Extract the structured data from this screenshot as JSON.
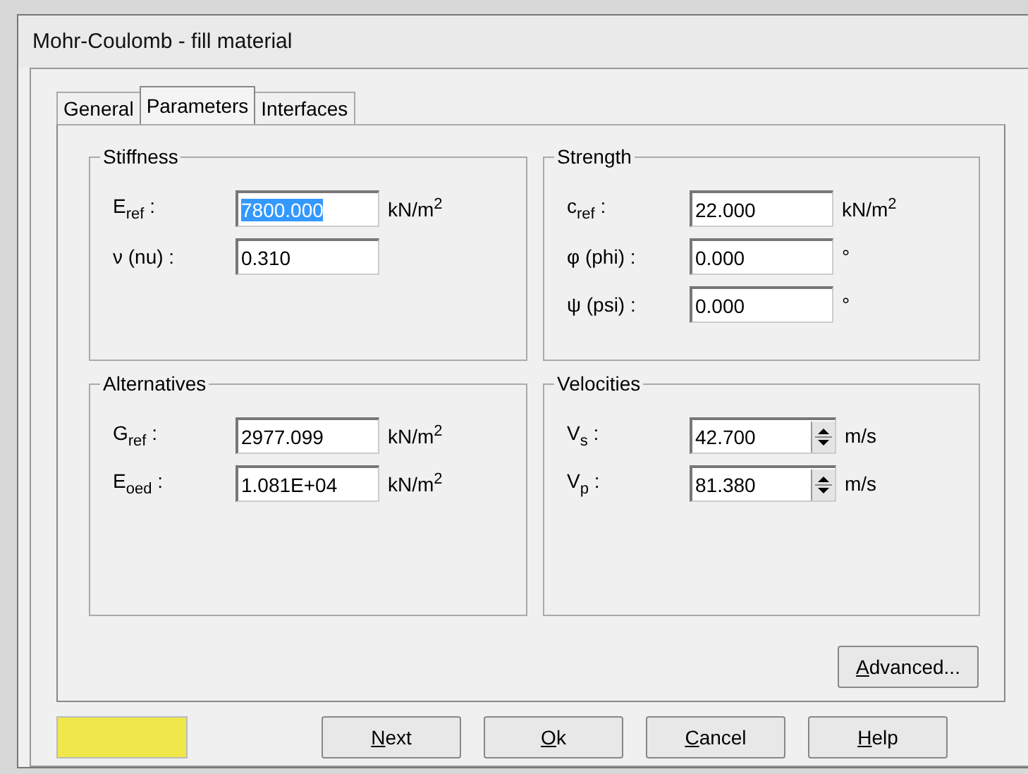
{
  "window": {
    "title": "Mohr-Coulomb - fill material"
  },
  "tabs": [
    {
      "label": "General",
      "selected": false
    },
    {
      "label": "Parameters",
      "selected": true
    },
    {
      "label": "Interfaces",
      "selected": false
    }
  ],
  "groups": [
    {
      "title": "Stiffness",
      "fields": [
        {
          "label": "E$_{ref}$ :",
          "value": "7800.000",
          "unit": "kN/m$^{2}$",
          "kind": "text",
          "selected": true
        },
        {
          "label": "ν (nu) :",
          "value": "0.310",
          "kind": "text",
          "selected": false
        }
      ]
    },
    {
      "title": "Strength",
      "fields": [
        {
          "label": "c$_{ref}$ :",
          "value": "22.000",
          "unit": "kN/m$^{2}$",
          "kind": "text",
          "selected": false
        },
        {
          "label": "φ (phi) :",
          "value": "0.000",
          "unit": "°",
          "kind": "text",
          "selected": false
        },
        {
          "label": "ψ (psi) :",
          "value": "0.000",
          "unit": "°",
          "kind": "text",
          "selected": false
        }
      ]
    },
    {
      "title": "Alternatives",
      "fields": [
        {
          "label": "G$_{ref}$ :",
          "value": "2977.099",
          "unit": "kN/m$^{2}$",
          "kind": "text",
          "selected": false
        },
        {
          "label": "E$_{oed}$ :",
          "value": "1.081E+04",
          "unit": "kN/m$^{2}$",
          "kind": "text",
          "selected": false
        }
      ]
    },
    {
      "title": "Velocities",
      "fields": [
        {
          "label": "V$_{s}$ :",
          "value": "42.700",
          "unit": "m/s",
          "kind": "spin",
          "selected": false
        },
        {
          "label": "V$_{p}$ :",
          "value": "81.380",
          "unit": "m/s",
          "kind": "spin",
          "selected": false
        }
      ]
    }
  ],
  "advanced_button": "Advanced...",
  "color_swatch": {
    "color": "#f0e84a"
  },
  "buttons": [
    "Next",
    "Ok",
    "Cancel",
    "Help"
  ]
}
